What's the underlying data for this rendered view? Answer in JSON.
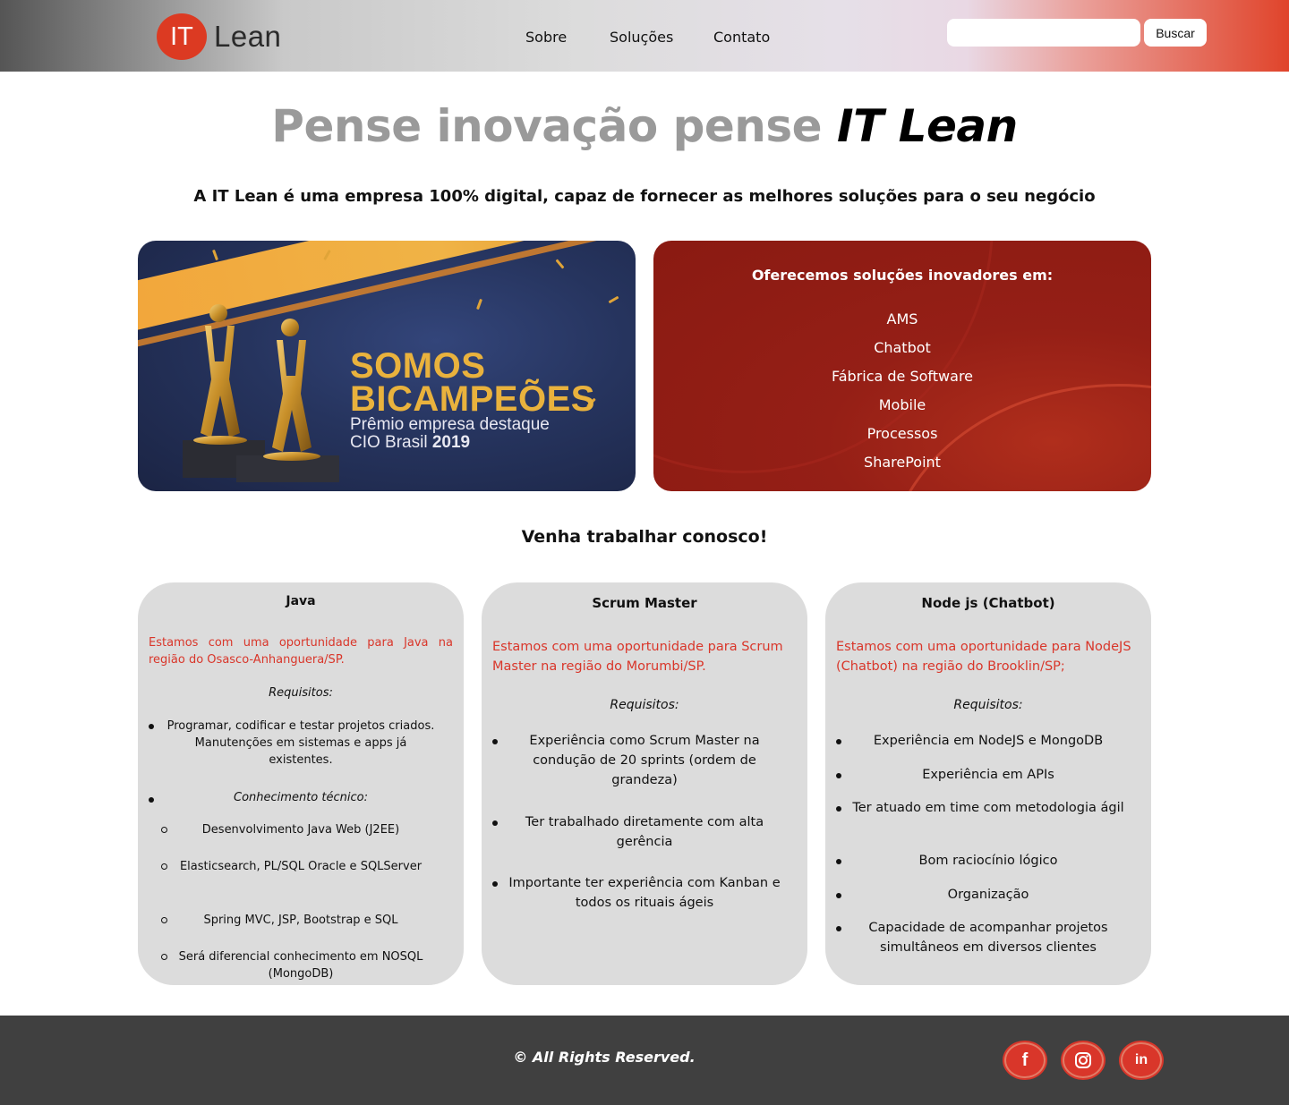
{
  "header": {
    "logo_mark": "IT",
    "logo_text": "Lean",
    "nav": [
      "Sobre",
      "Soluções",
      "Contato"
    ],
    "search_placeholder": "",
    "search_button": "Buscar"
  },
  "hero": {
    "title_prefix": "Pense inovação pense ",
    "title_brand": "IT Lean",
    "subtitle": "A IT Lean é uma empresa 100% digital, capaz de fornecer as melhores soluções para o seu negócio"
  },
  "banner": {
    "line1": "SOMOS",
    "line2": "BICAMPEÕES",
    "line3": "Prêmio empresa destaque",
    "line4a": "CIO Brasil ",
    "line4b": "2019"
  },
  "solutions": {
    "title": "Oferecemos soluções inovadores em:",
    "items": [
      "AMS",
      "Chatbot",
      "Fábrica de Software",
      "Mobile",
      "Processos",
      "SharePoint"
    ]
  },
  "careers": {
    "title": "Venha trabalhar conosco!",
    "cards": [
      {
        "title": "Java",
        "desc": "Estamos com uma oportunidade para Java na região do Osasco-Anhanguera/SP.",
        "req": "Requisitos:",
        "items": [
          "Programar, codificar e testar projetos criados. Manutenções em sistemas e apps já existentes.",
          "Conhecimento técnico:"
        ],
        "subitems": [
          "Desenvolvimento Java Web (J2EE)",
          "Elasticsearch, PL/SQL Oracle e SQLServer",
          "Spring MVC, JSP, Bootstrap e SQL",
          "Será diferencial conhecimento em NOSQL (MongoDB)"
        ]
      },
      {
        "title": "Scrum Master",
        "desc": "Estamos com uma oportunidade para Scrum Master na região do Morumbi/SP.",
        "req": "Requisitos:",
        "items": [
          "Experiência como Scrum Master na condução de 20 sprints (ordem de grandeza)",
          "Ter trabalhado diretamente com alta gerência",
          "Importante ter experiência com Kanban e todos os rituais ágeis"
        ]
      },
      {
        "title": "Node js (Chatbot)",
        "desc": "Estamos com uma oportunidade para NodeJS (Chatbot) na região do Brooklin/SP;",
        "req": "Requisitos:",
        "items": [
          "Experiência em NodeJS e MongoDB",
          "Experiência em APIs",
          "Ter atuado em time com metodologia ágil",
          "Bom raciocínio lógico",
          "Organização",
          "Capacidade de acompanhar projetos simultâneos em diversos clientes"
        ]
      }
    ]
  },
  "footer": {
    "copyright": "© All Rights Reserved.",
    "social": [
      {
        "name": "facebook-icon",
        "glyph": "f"
      },
      {
        "name": "instagram-icon",
        "glyph": ""
      },
      {
        "name": "linkedin-icon",
        "glyph": "in"
      }
    ]
  },
  "colors": {
    "accent": "#dc3a22",
    "card_bg": "#dcdcdc",
    "footer_bg": "#404040",
    "solutions_bg": "#951f16"
  }
}
